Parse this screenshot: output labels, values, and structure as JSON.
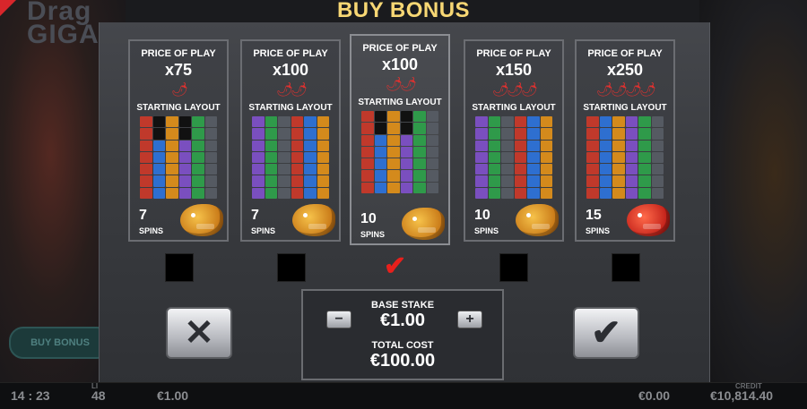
{
  "title": "BUY BONUS",
  "background": {
    "logo_text": "Drag\nGIGA",
    "buy_bonus_button": "BUY BONUS"
  },
  "cards": [
    {
      "price_label": "PRICE OF PLAY",
      "multiplier": "x75",
      "chilis": "🌶",
      "layout_label": "STARTING LAYOUT",
      "spins": "7",
      "spins_label": "SPINS",
      "dragon": "gold-dragon-icon",
      "selected": false
    },
    {
      "price_label": "PRICE OF PLAY",
      "multiplier": "x100",
      "chilis": "🌶🌶",
      "layout_label": "STARTING LAYOUT",
      "spins": "7",
      "spins_label": "SPINS",
      "dragon": "gold-dragon-icon",
      "selected": false
    },
    {
      "price_label": "PRICE OF PLAY",
      "multiplier": "x100",
      "chilis": "🌶🌶",
      "layout_label": "STARTING LAYOUT",
      "spins": "10",
      "spins_label": "SPINS",
      "dragon": "gold-dragon-icon",
      "selected": true
    },
    {
      "price_label": "PRICE OF PLAY",
      "multiplier": "x150",
      "chilis": "🌶🌶🌶",
      "layout_label": "STARTING LAYOUT",
      "spins": "10",
      "spins_label": "SPINS",
      "dragon": "gold-dragon-icon",
      "selected": false
    },
    {
      "price_label": "PRICE OF PLAY",
      "multiplier": "x250",
      "chilis": "🌶🌶🌶🌶",
      "layout_label": "STARTING LAYOUT",
      "spins": "15",
      "spins_label": "SPINS",
      "dragon": "red-dragon-icon",
      "selected": false
    }
  ],
  "stake": {
    "base_label": "BASE STAKE",
    "base_value": "€1.00",
    "minus": "−",
    "plus": "+",
    "total_label": "TOTAL COST",
    "total_value": "€100.00"
  },
  "buttons": {
    "cancel": "✕",
    "confirm": "✔"
  },
  "checkmark": "✔",
  "status_bar": {
    "time": "14 : 23",
    "lines_label": "LI",
    "lines": "48",
    "bet": "€1.00",
    "win": "€0.00",
    "credit_label": "CREDIT",
    "credit": "€10,814.40"
  },
  "colors": {
    "title": "#f7d774",
    "check": "#e8201c",
    "panel": "#3a3c40"
  }
}
